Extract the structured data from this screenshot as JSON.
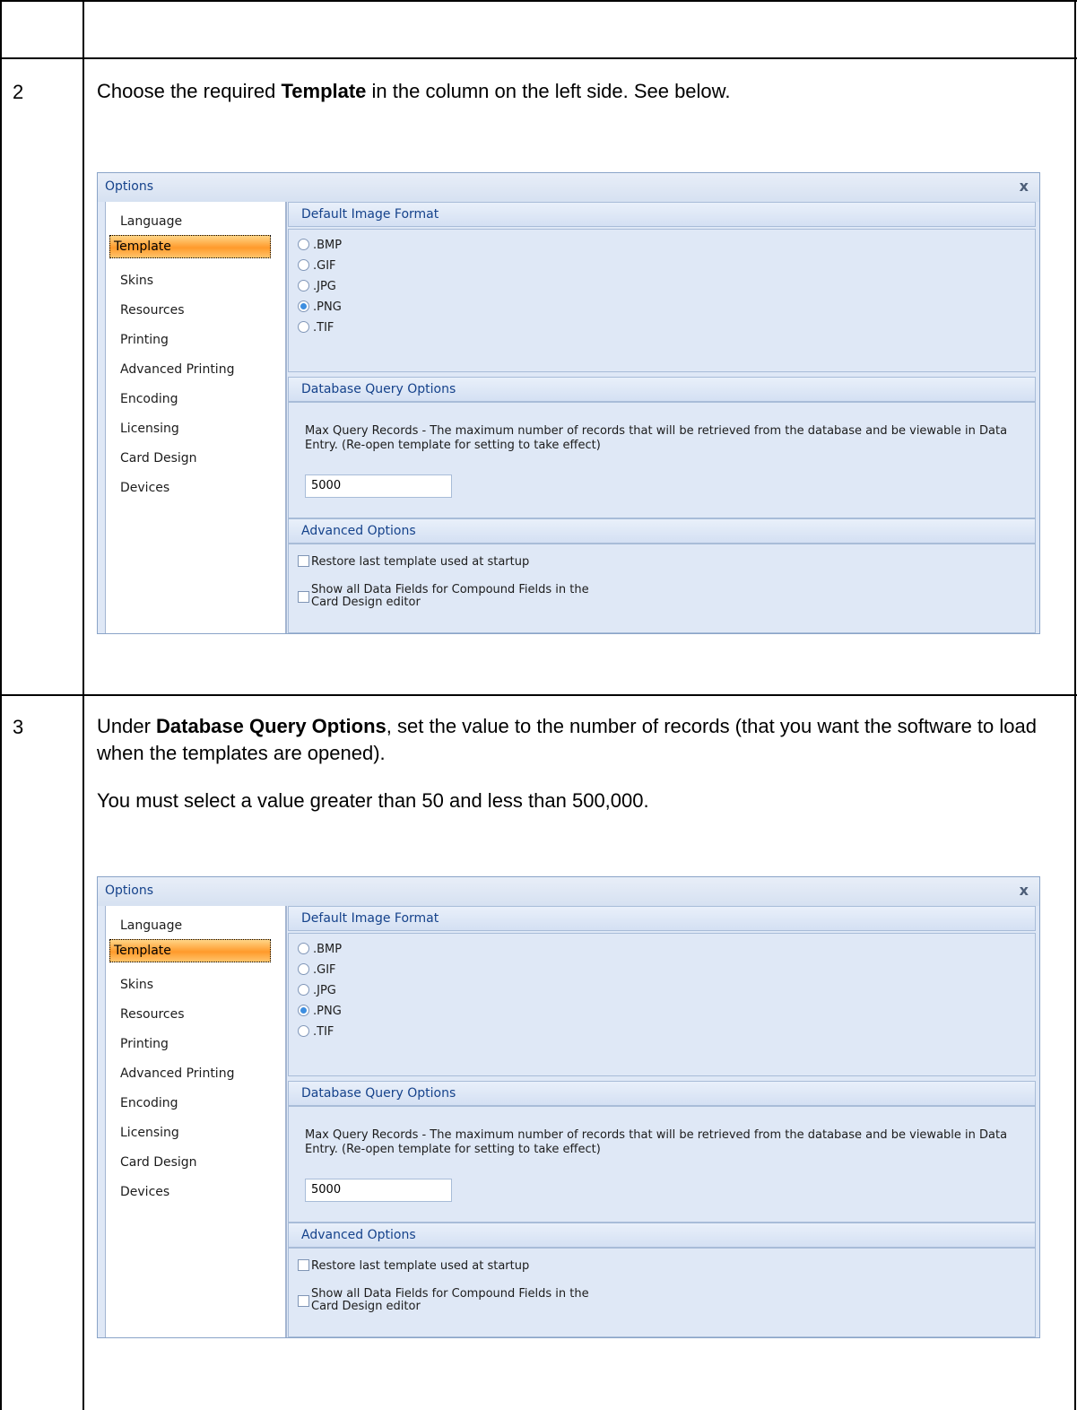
{
  "steps": [
    {
      "number": "2",
      "paragraphs": [
        {
          "before": "Choose the required ",
          "bold": "Template",
          "after": " in the column on the left side. See below."
        }
      ]
    },
    {
      "number": "3",
      "paragraphs": [
        {
          "before": "Under ",
          "bold": "Database Query Options",
          "after": ", set the value to the number of records (that you want the software to load when the templates are opened)."
        },
        {
          "before": "You must select a value greater than 50 and less than 500,000.",
          "bold": "",
          "after": ""
        }
      ]
    }
  ],
  "dialog": {
    "title": "Options",
    "close_icon": "close-icon",
    "nav_items": [
      "Language",
      "Template",
      "Skins",
      "Resources",
      "Printing",
      "Advanced Printing",
      "Encoding",
      "Licensing",
      "Card Design",
      "Devices"
    ],
    "selected_nav": "Template",
    "image_format": {
      "header": "Default Image Format",
      "options": [
        ".BMP",
        ".GIF",
        ".JPG",
        ".PNG",
        ".TIF"
      ],
      "selected": ".PNG"
    },
    "query": {
      "header": "Database Query Options",
      "description": "Max Query Records - The maximum number of records that will be retrieved from the database and be viewable in Data Entry. (Re-open template for setting to take effect)",
      "value": "5000"
    },
    "advanced": {
      "header": "Advanced Options",
      "restore_label": "Restore last template used at startup",
      "restore_checked": false,
      "show_fields_line1": "Show all Data Fields for Compound Fields in the",
      "show_fields_line2": "Card Design editor",
      "show_fields_checked": false
    }
  }
}
